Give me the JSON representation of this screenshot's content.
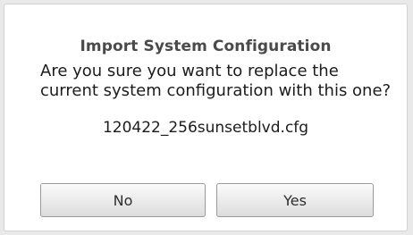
{
  "dialog": {
    "title": "Import System Configuration",
    "message": "Are you sure you want to replace the current system configuration with this one?",
    "filename": "120422_256sunsetblvd.cfg",
    "buttons": {
      "no_label": "No",
      "yes_label": "Yes"
    }
  },
  "colors": {
    "background": "#e9e9e9",
    "dialog_background": "#ffffff",
    "title_text": "#4a4a4a",
    "body_text": "#1c1c1c"
  }
}
